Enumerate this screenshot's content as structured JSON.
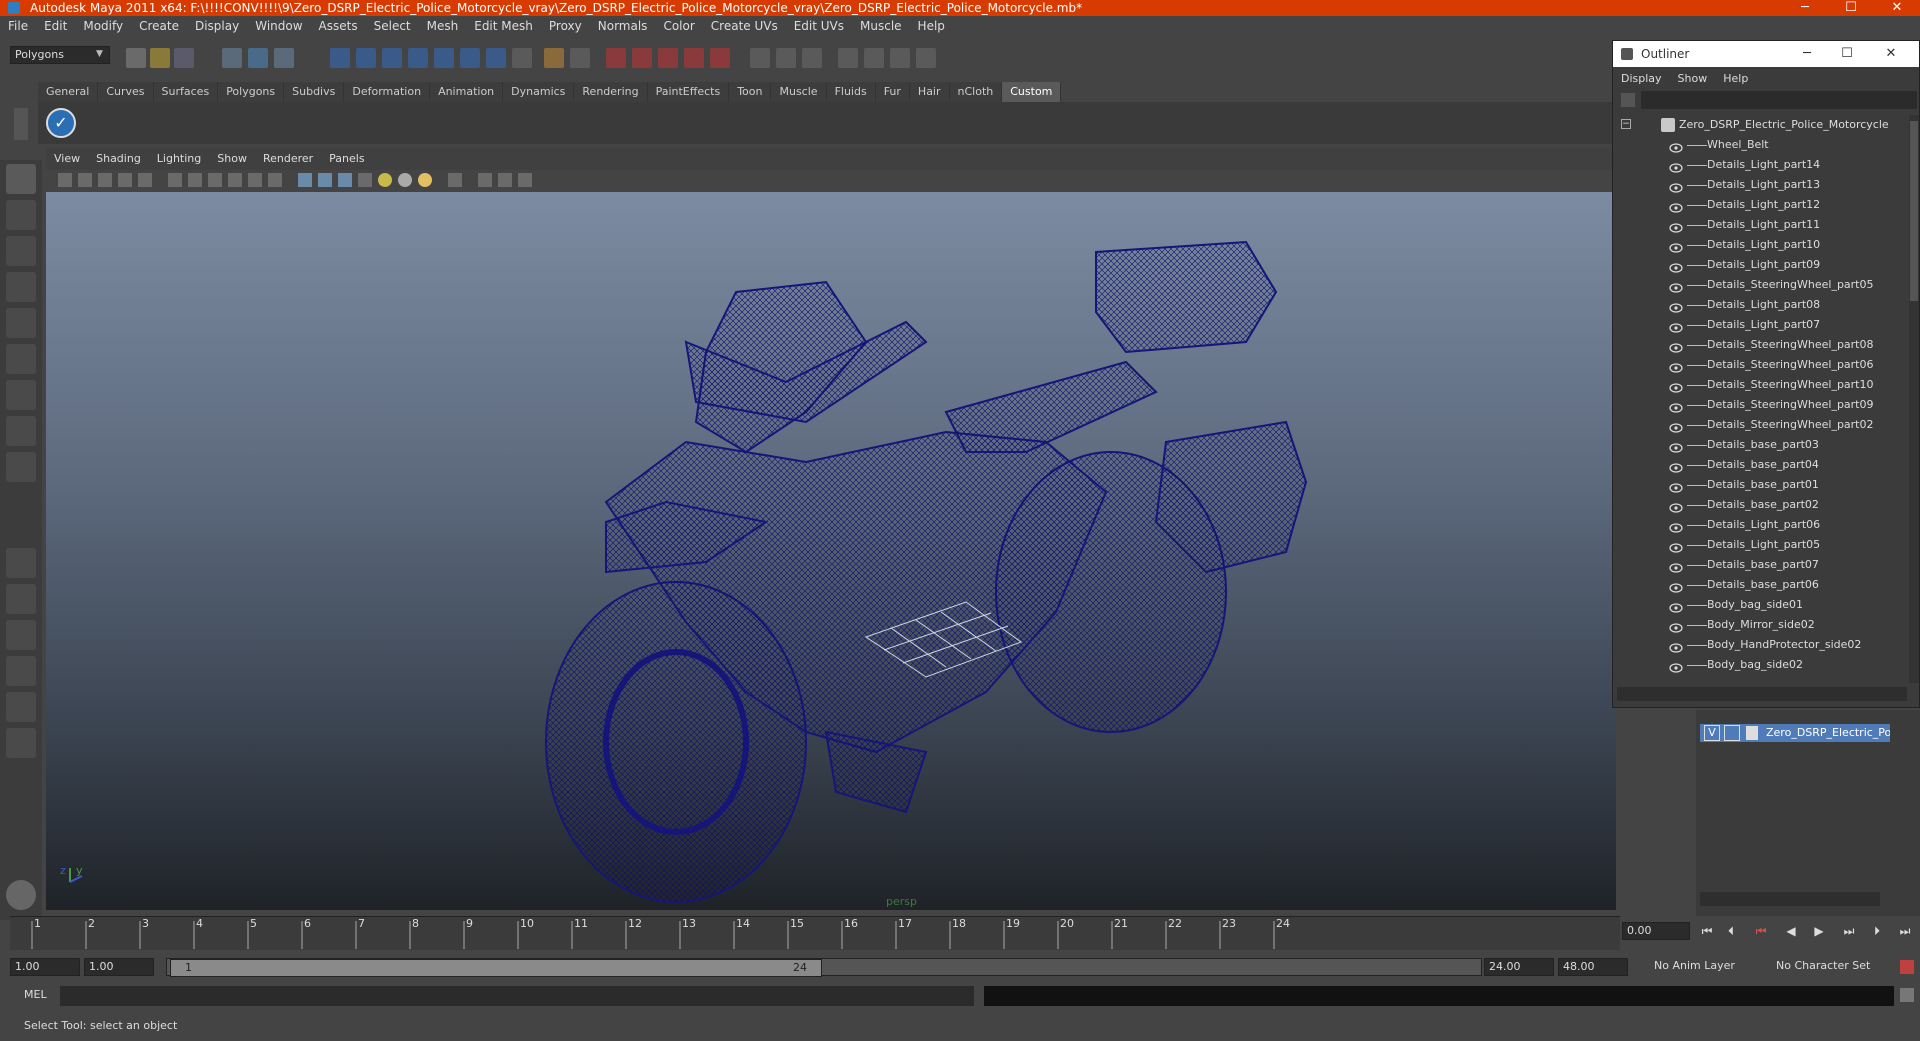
{
  "window": {
    "title": "Autodesk Maya 2011 x64: F:\\!!!!CONV!!!!\\9\\Zero_DSRP_Electric_Police_Motorcycle_vray\\Zero_DSRP_Electric_Police_Motorcycle_vray\\Zero_DSRP_Electric_Police_Motorcycle.mb*",
    "minimize": "─",
    "maximize": "☐",
    "close": "✕"
  },
  "menubar": [
    "File",
    "Edit",
    "Modify",
    "Create",
    "Display",
    "Window",
    "Assets",
    "Select",
    "Mesh",
    "Edit Mesh",
    "Proxy",
    "Normals",
    "Color",
    "Create UVs",
    "Edit UVs",
    "Muscle",
    "Help"
  ],
  "status": {
    "mode": "Polygons"
  },
  "shelf": {
    "tabs": [
      "General",
      "Curves",
      "Surfaces",
      "Polygons",
      "Subdivs",
      "Deformation",
      "Animation",
      "Dynamics",
      "Rendering",
      "PaintEffects",
      "Toon",
      "Muscle",
      "Fluids",
      "Fur",
      "Hair",
      "nCloth",
      "Custom"
    ],
    "active_tab": "Custom"
  },
  "viewport": {
    "menu": [
      "View",
      "Shading",
      "Lighting",
      "Show",
      "Renderer",
      "Panels"
    ],
    "camera_label": "persp",
    "axis_y": "y",
    "axis_z": "z",
    "model_color": "#1a1a7a"
  },
  "timeline": {
    "ticks": [
      "1",
      "2",
      "3",
      "4",
      "5",
      "6",
      "7",
      "8",
      "9",
      "10",
      "11",
      "12",
      "13",
      "14",
      "15",
      "16",
      "17",
      "18",
      "19",
      "20",
      "21",
      "22",
      "23",
      "24"
    ],
    "current_time": "0.00"
  },
  "range": {
    "start": "1.00",
    "playback_start": "1.00",
    "slider_start": "1",
    "slider_end": "24",
    "playback_end": "24.00",
    "end": "48.00",
    "anim_layer": "No Anim Layer",
    "character_set": "No Character Set"
  },
  "cmdline": {
    "label": "MEL"
  },
  "helpline": {
    "text": "Select Tool: select an object"
  },
  "outliner": {
    "title": "Outliner",
    "menu": [
      "Display",
      "Show",
      "Help"
    ],
    "root": "Zero_DSRP_Electric_Police_Motorcycle",
    "items": [
      "Wheel_Belt",
      "Details_Light_part14",
      "Details_Light_part13",
      "Details_Light_part12",
      "Details_Light_part11",
      "Details_Light_part10",
      "Details_Light_part09",
      "Details_SteeringWheel_part05",
      "Details_Light_part08",
      "Details_Light_part07",
      "Details_SteeringWheel_part08",
      "Details_SteeringWheel_part06",
      "Details_SteeringWheel_part10",
      "Details_SteeringWheel_part09",
      "Details_SteeringWheel_part02",
      "Details_base_part03",
      "Details_base_part04",
      "Details_base_part01",
      "Details_base_part02",
      "Details_Light_part06",
      "Details_Light_part05",
      "Details_base_part07",
      "Details_base_part06",
      "Body_bag_side01",
      "Body_Mirror_side02",
      "Body_HandProtector_side02",
      "Body_bag_side02"
    ]
  },
  "layers": {
    "visible_flag": "V",
    "layer_name": "Zero_DSRP_Electric_Police_Motorcycle"
  }
}
